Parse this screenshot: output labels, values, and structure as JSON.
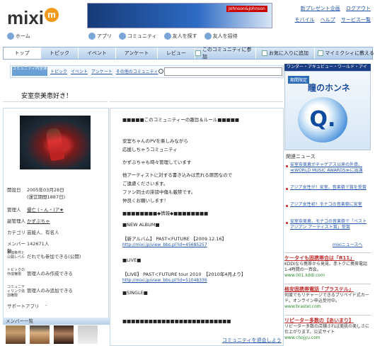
{
  "header": {
    "logo_text": "mixi",
    "logo_badge": "m",
    "banner_badge": "Johnson&Johnson",
    "toplinks": [
      "新プレゼント企画",
      "ログアウト"
    ],
    "toplinks2": [
      "モバイル",
      "ヘルプ",
      "サービス一覧"
    ],
    "home_label": "ホーム",
    "nav": [
      "アプリ",
      "コミュニティ",
      "友人を探す",
      "友人を招待"
    ]
  },
  "tabs": [
    {
      "label": "トップ",
      "active": true
    },
    {
      "label": "トピック"
    },
    {
      "label": "イベント"
    },
    {
      "label": "アンケート"
    },
    {
      "label": "レビュー"
    },
    {
      "label": "このコミュニティに参加"
    },
    {
      "label": "お気に入りに追加"
    },
    {
      "label": "マイミクシィに教える"
    }
  ],
  "subnav": {
    "pill": "コミュニティ内全体",
    "links": [
      "トピック",
      "イベント",
      "アンケート",
      "その他のコミュニティ"
    ],
    "search_value": ""
  },
  "community_title": "安室奈美恵好き！",
  "info": {
    "rows": [
      {
        "k": "開設日",
        "v": "2005年03月28日",
        "v2": "(運営期間1887日)"
      },
      {
        "k": "管理人",
        "v": "優亡 (・ん・)ア★",
        "link": true
      },
      {
        "k": "副管理人",
        "v": "かずぶちゃ",
        "link": true
      },
      {
        "k": "カテゴリ",
        "v": "芸能人、有名人"
      },
      {
        "k": "メンバー数",
        "v": "142671人"
      },
      {
        "k": "参加条件と公開レベル",
        "v": "だれでも参加できる(公開)"
      },
      {
        "k": "トピックの作成権限",
        "v": "管理人のみ作成できる"
      },
      {
        "k": "コミュニティリンク追加権限",
        "v": "管理人のみ追加できる"
      },
      {
        "k": "サポートアプリ",
        "v": "-"
      }
    ],
    "member_bar": "メンバー一覧"
  },
  "center": {
    "lines": [
      "■■■■■このコミュニティーの趣旨＆ルール■■■■■",
      "安室ちゃんのPVを楽しみながら",
      "応援しちゃうコミュニティ",
      "かずぶちゃも時々管理しています",
      "他アーティストに対する書き込みは荒れる原因なので",
      "ご遠慮くださいます。",
      "ファン同士の誹謗中傷も厳禁です。",
      "仲良くお願いします！",
      "■■■■■■■■◆情報◆■■■■■■■■",
      "■NEW ALBUM■",
      "【新アルバム】 PAST<FUTURE 【2009.12.16】",
      "■LIVE■",
      "【LIVE】 PAST＜FUTURE tour 2010　【2010年4月より】",
      "■SINGLE■",
      "■■■■■■■■■■■■■■■■■■■■■■■■■"
    ],
    "links": [
      "http://mixi.jp/view_bbs.pl?id=45685257",
      "http://mixi.jp/view_bbs.pl?id=51048336"
    ],
    "footer_link": "コミュニティを退会しよう"
  },
  "right": {
    "ad_header": "ワンダー・アキュビュー・ワールド・アイ×mixi",
    "ad_pill": "期間限定",
    "ad_caption": "瞳のホンネ",
    "ad_letter": "Q.",
    "news_head": "関連ニュース",
    "news": [
      "安室奈美恵がチャゲアス以来の外資、≪WORLD MUSIC AWARDS≫に出演",
      "アジア女性が！安室、音楽祭で賞を受賞",
      "アジア女性初！モナコの音楽祭に安室",
      "安室奈美恵、モナコの音楽祭で「ベストアジアン アーティスト賞」受賞"
    ],
    "news_more": "mixiニュースへ",
    "ads": [
      {
        "h": "ケータイも固携帯合は「R11」",
        "b": "KDDIなら携帯から発見、赤トクに携帯電話1-4時間の一斉会。",
        "u": "www.001.kddi.com"
      },
      {
        "h": "格安固携帯電話「プラステル」",
        "b": "何度でもリチャージできるプリペイド式カード。オンライン申込受付中。",
        "u": "www.brastel.com"
      },
      {
        "h": "リピーター多数の【あいまり】",
        "b": "リピーター多数の店舗されば美肌の美しさに仕上がります。公式サイト",
        "u": "www.chojyu.com"
      }
    ]
  }
}
